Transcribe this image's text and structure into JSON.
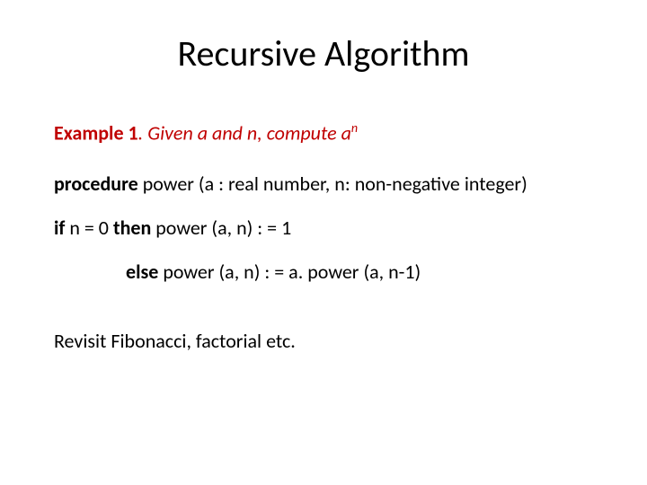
{
  "title": "Recursive Algorithm",
  "example": {
    "label": "Example 1",
    "text": ". Given a and n, compute a",
    "superscript": "n"
  },
  "procedure": {
    "keyword": "procedure",
    "rest": " power (a : real number, n: non-negative integer)"
  },
  "ifline": {
    "if_kw": "if",
    "cond": " n = 0 ",
    "then_kw": "then",
    "rest": " power (a, n) : = 1"
  },
  "elseline": {
    "else_kw": "else",
    "rest": " power (a, n) : = a. power (a, n-1)"
  },
  "revisit": "Revisit Fibonacci, factorial etc."
}
